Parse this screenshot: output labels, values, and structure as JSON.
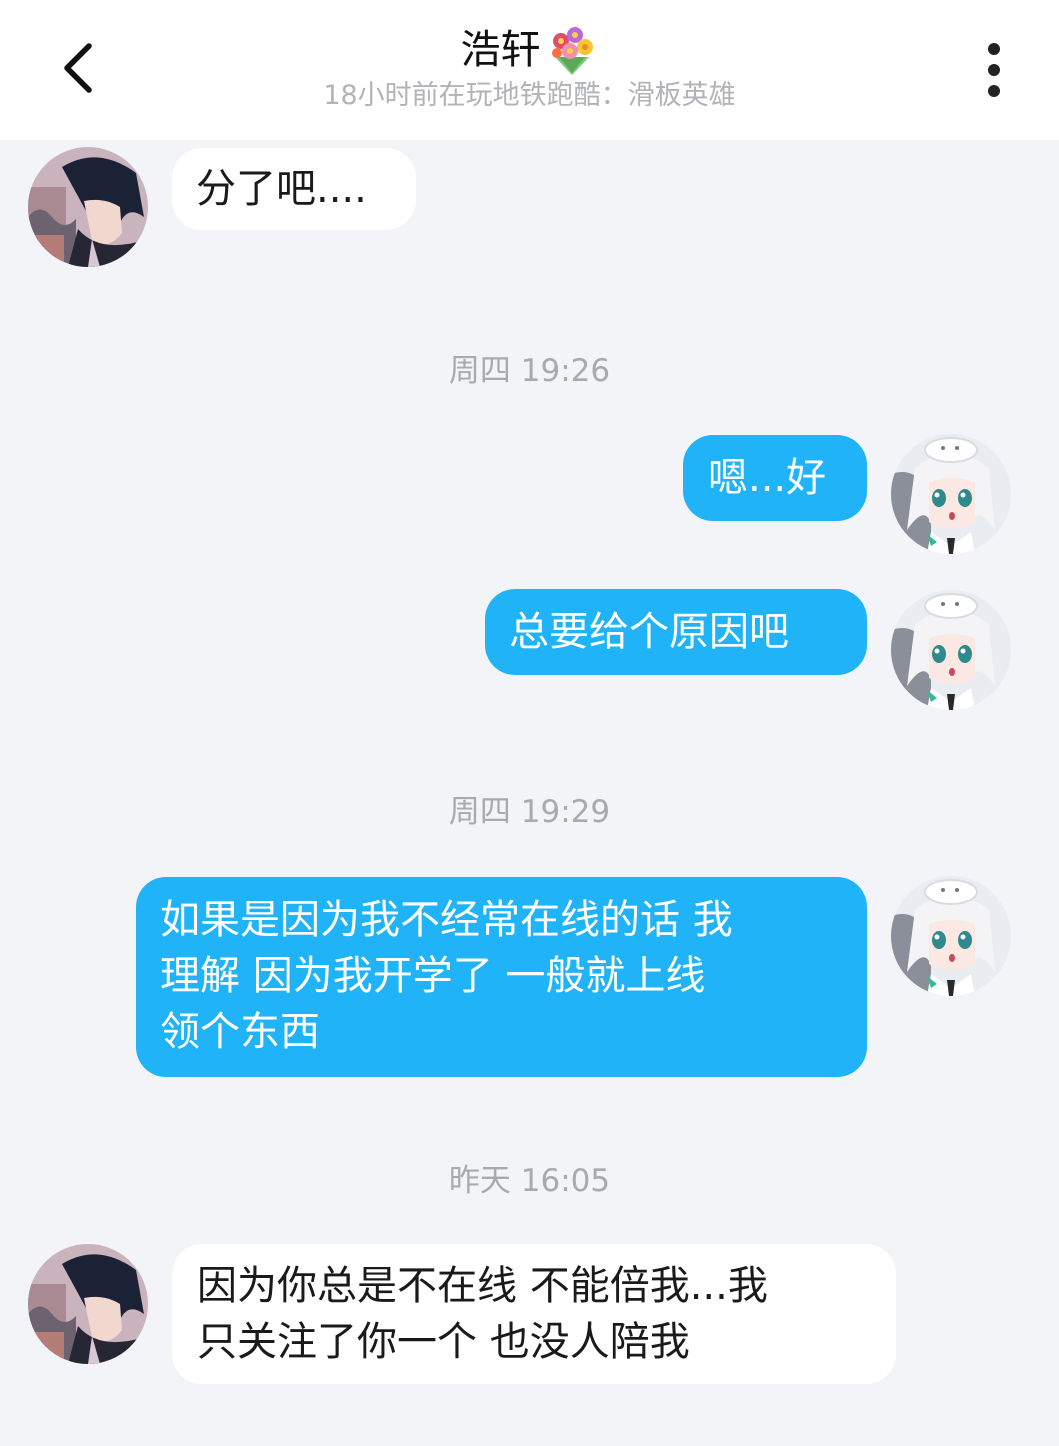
{
  "header": {
    "title": "浩轩",
    "title_emoji": "bouquet-icon",
    "status": "18小时前在玩地铁跑酷：滑板英雄",
    "back_icon": "chevron-left-icon",
    "more_icon": "more-vertical-icon"
  },
  "colors": {
    "header_bg": "#ffffff",
    "chat_bg": "#f3f4f8",
    "outgoing_bubble": "#20b3f7",
    "incoming_bubble": "#ffffff"
  },
  "messages": [
    {
      "side": "left",
      "text": "分了吧...."
    },
    {
      "type": "time",
      "text": "周四 19:26"
    },
    {
      "side": "right",
      "text": "嗯...好"
    },
    {
      "side": "right",
      "text": "总要给个原因吧"
    },
    {
      "type": "time",
      "text": "周四 19:29"
    },
    {
      "side": "right",
      "lines": [
        "如果是因为我不经常在线的话 我",
        "理解 因为我开学了 一般就上线",
        "领个东西"
      ]
    },
    {
      "type": "time",
      "text": "昨天 16:05"
    },
    {
      "side": "left",
      "lines": [
        "因为你总是不在线 不能倍我...我",
        "只关注了你一个 也没人陪我"
      ]
    }
  ]
}
